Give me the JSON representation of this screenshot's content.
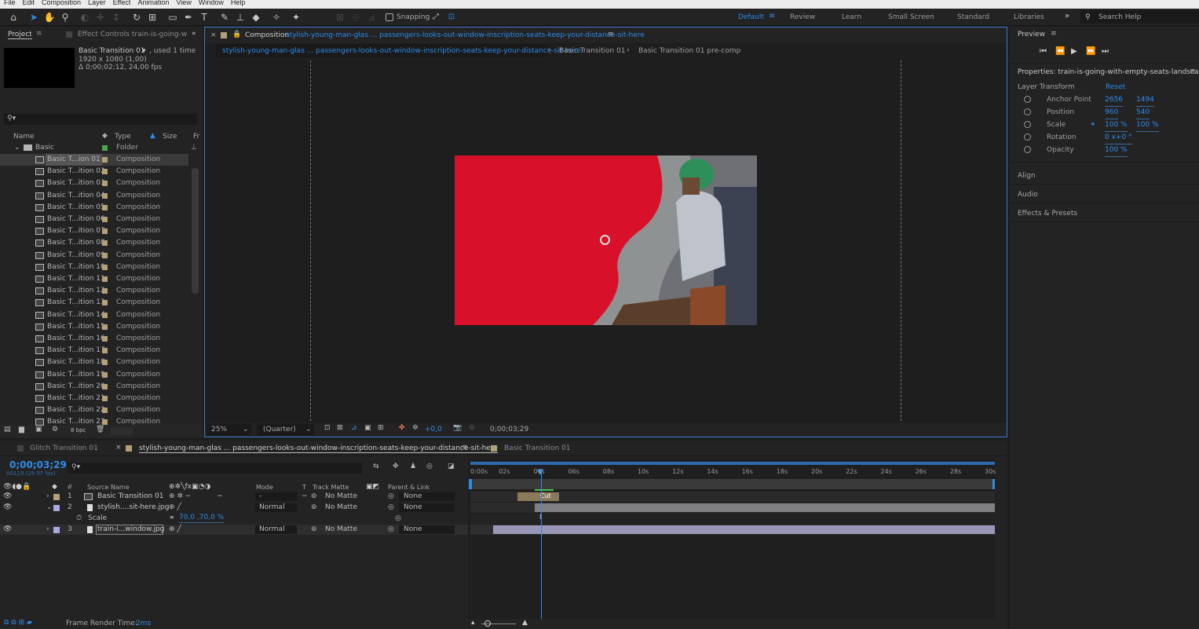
{
  "menu": [
    "File",
    "Edit",
    "Composition",
    "Layer",
    "Effect",
    "Animation",
    "View",
    "Window",
    "Help"
  ],
  "toolbar": {
    "snapping_label": "Snapping"
  },
  "workspaces": {
    "default": "Default",
    "review": "Review",
    "learn": "Learn",
    "small_screen": "Small Screen",
    "standard": "Standard",
    "libraries": "Libraries",
    "search": "Search Help"
  },
  "project": {
    "tab_label": "Project",
    "effect_controls_label": "Effect Controls train-is-going-w",
    "selected_name": "Basic Transition 01",
    "used_text": ", used 1 time",
    "dimensions": "1920 x 1080 (1,00)",
    "duration": "Δ 0;00;02;12, 24,00 fps",
    "columns": {
      "name": "Name",
      "type": "Type",
      "size": "Size",
      "fr": "Fr"
    },
    "folder": {
      "name": "Basic",
      "type": "Folder"
    },
    "items": [
      {
        "name": "Basic T...ion 01",
        "type": "Composition"
      },
      {
        "name": "Basic T...ition 02",
        "type": "Composition"
      },
      {
        "name": "Basic T...ition 03",
        "type": "Composition"
      },
      {
        "name": "Basic T...ition 04",
        "type": "Composition"
      },
      {
        "name": "Basic T...ition 05",
        "type": "Composition"
      },
      {
        "name": "Basic T...ition 06",
        "type": "Composition"
      },
      {
        "name": "Basic T...ition 07",
        "type": "Composition"
      },
      {
        "name": "Basic T...ition 08",
        "type": "Composition"
      },
      {
        "name": "Basic T...ition 09",
        "type": "Composition"
      },
      {
        "name": "Basic T...ition 10",
        "type": "Composition"
      },
      {
        "name": "Basic T...ition 11",
        "type": "Composition"
      },
      {
        "name": "Basic T...ition 12",
        "type": "Composition"
      },
      {
        "name": "Basic T...ition 13",
        "type": "Composition"
      },
      {
        "name": "Basic T...ition 14",
        "type": "Composition"
      },
      {
        "name": "Basic T...ition 15",
        "type": "Composition"
      },
      {
        "name": "Basic T...ition 16",
        "type": "Composition"
      },
      {
        "name": "Basic T...ition 17",
        "type": "Composition"
      },
      {
        "name": "Basic T...ition 18",
        "type": "Composition"
      },
      {
        "name": "Basic T...ition 19",
        "type": "Composition"
      },
      {
        "name": "Basic T...ition 20",
        "type": "Composition"
      },
      {
        "name": "Basic T...ition 21",
        "type": "Composition"
      },
      {
        "name": "Basic T...ition 22",
        "type": "Composition"
      },
      {
        "name": "Basic T...ition 23",
        "type": "Composition"
      }
    ],
    "bpc": "8 bpc"
  },
  "composition": {
    "tab_prefix": "Composition",
    "tab_name": "stylish-young-man-glas ... passengers-looks-out-window-inscription-seats-keep-your-distance-sit-here",
    "breadcrumb": [
      "stylish-young-man-glas ... passengers-looks-out-window-inscription-seats-keep-your-distance-sit-here",
      "Basic Transition 01",
      "Basic Transition 01 pre-comp"
    ],
    "zoom": "25%",
    "resolution": "(Quarter)",
    "exposure": "+0,0",
    "timecode": "0;00;03;29"
  },
  "preview": {
    "title": "Preview"
  },
  "properties": {
    "title": "Properties: train-is-going-with-empty-seats-landscap",
    "section": "Layer Transform",
    "reset": "Reset",
    "rows": [
      {
        "label": "Anchor Point",
        "v1": "2656",
        "v2": "1494"
      },
      {
        "label": "Position",
        "v1": "960",
        "v2": "540"
      },
      {
        "label": "Scale",
        "v1": "100 %",
        "v2": "100 %"
      },
      {
        "label": "Rotation",
        "v1": "0 x+0 °",
        "v2": ""
      },
      {
        "label": "Opacity",
        "v1": "100 %",
        "v2": ""
      }
    ],
    "align": "Align",
    "audio": "Audio",
    "effects": "Effects & Presets"
  },
  "timeline": {
    "tabs": [
      "Glitch Transition 01",
      "stylish-young-man-glas ... passengers-looks-out-window-inscription-seats-keep-your-distance-sit-here",
      "Basic Transition 01"
    ],
    "timecode": "0;00;03;29",
    "frame_info": "00119 (29.97 fps)",
    "headers": {
      "source": "Source Name",
      "mode": "Mode",
      "t": "T",
      "track_matte": "Track Matte",
      "parent": "Parent & Link"
    },
    "layers": [
      {
        "num": "1",
        "name": "Basic Transition 01",
        "mode": "-",
        "matte": "No Matte",
        "parent": "None"
      },
      {
        "num": "2",
        "name": "stylish....sit-here.jpg",
        "mode": "Normal",
        "matte": "No Matte",
        "parent": "None"
      },
      {
        "num": "3",
        "name": "train-i...window.jpg",
        "mode": "Normal",
        "matte": "No Matte",
        "parent": "None"
      }
    ],
    "scale_label": "Scale",
    "scale_value": "70,0 ,70,0 %",
    "ruler": [
      "0:00s",
      "02s",
      "04s",
      "06s",
      "08s",
      "10s",
      "12s",
      "14s",
      "16s",
      "18s",
      "20s",
      "22s",
      "24s",
      "26s",
      "28s",
      "30s"
    ],
    "cut_label": "Cut",
    "render_label": "Frame Render Time:",
    "render_value": "2ms"
  }
}
